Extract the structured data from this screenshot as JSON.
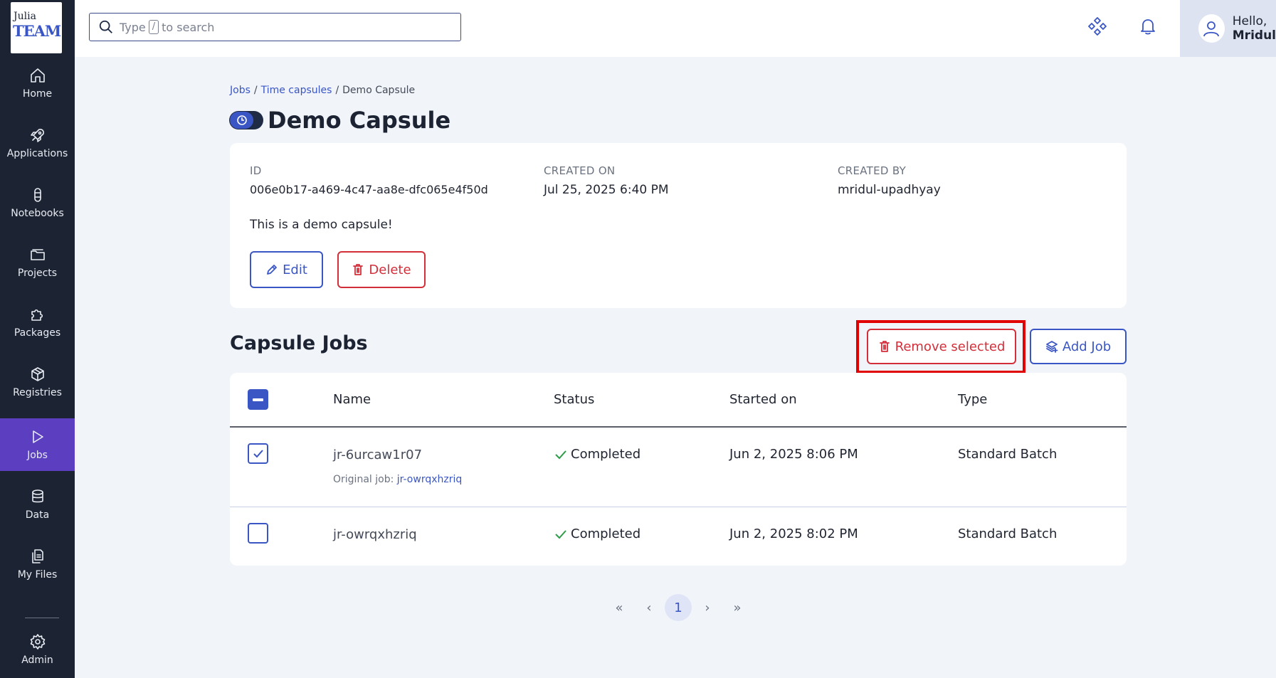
{
  "brand": {
    "line1": "Julia",
    "line2": "TEAM"
  },
  "sidebar": {
    "items": [
      {
        "label": "Home",
        "icon": "home-icon"
      },
      {
        "label": "Applications",
        "icon": "rocket-icon"
      },
      {
        "label": "Notebooks",
        "icon": "notebook-icon"
      },
      {
        "label": "Projects",
        "icon": "folder-icon"
      },
      {
        "label": "Packages",
        "icon": "puzzle-icon"
      },
      {
        "label": "Registries",
        "icon": "box-icon"
      },
      {
        "label": "Jobs",
        "icon": "play-icon",
        "active": true
      },
      {
        "label": "Data",
        "icon": "database-icon"
      },
      {
        "label": "My Files",
        "icon": "files-icon"
      },
      {
        "label": "Admin",
        "icon": "gear-icon"
      }
    ]
  },
  "search": {
    "prefix": "Type",
    "key": "/",
    "suffix": "to search"
  },
  "user": {
    "greeting": "Hello,",
    "name": "Mridul"
  },
  "breadcrumb": {
    "items": [
      "Jobs",
      "Time capsules",
      "Demo Capsule"
    ]
  },
  "capsule": {
    "title": "Demo Capsule",
    "id_label": "ID",
    "id_value": "006e0b17-a469-4c47-aa8e-dfc065e4f50d",
    "created_on_label": "CREATED ON",
    "created_on_value": "Jul 25, 2025 6:40 PM",
    "created_by_label": "CREATED BY",
    "created_by_value": "mridul-upadhyay",
    "description": "This is a demo capsule!",
    "edit_label": "Edit",
    "delete_label": "Delete"
  },
  "jobs_section": {
    "title": "Capsule Jobs",
    "remove_selected_label": "Remove selected",
    "add_job_label": "Add Job",
    "columns": [
      "Name",
      "Status",
      "Started on",
      "Type"
    ],
    "rows": [
      {
        "name": "jr-6urcaw1r07",
        "original_label": "Original job:",
        "original_job": "jr-owrqxhzriq",
        "status": "Completed",
        "started_on": "Jun 2, 2025 8:06 PM",
        "type": "Standard Batch",
        "checked": true
      },
      {
        "name": "jr-owrqxhzriq",
        "status": "Completed",
        "started_on": "Jun 2, 2025 8:02 PM",
        "type": "Standard Batch",
        "checked": false
      }
    ]
  },
  "pagination": {
    "first": "«",
    "prev": "‹",
    "current": "1",
    "next": "›",
    "last": "»"
  },
  "colors": {
    "sidebar_bg": "#1c2333",
    "active_nav": "#5b3fc0",
    "accent": "#3a56c5",
    "danger": "#d32f3a",
    "success": "#2e9d4a",
    "highlight": "#e00000"
  }
}
